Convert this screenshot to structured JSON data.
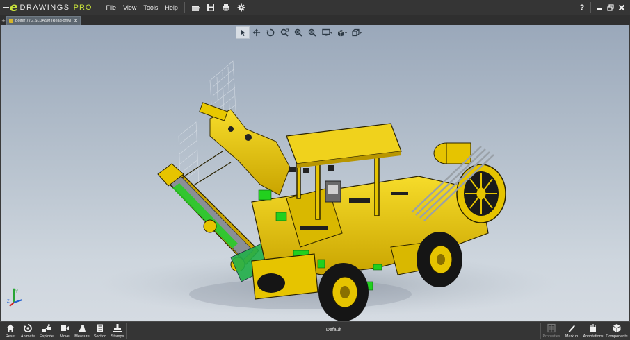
{
  "app": {
    "logo_word": "DRAWINGS",
    "logo_pro": "PRO",
    "menus": [
      "File",
      "View",
      "Tools",
      "Help"
    ],
    "help_glyph": "?"
  },
  "toolbar_icons": [
    "open-file-icon",
    "save-icon",
    "print-icon",
    "settings-gear-icon"
  ],
  "tabs": {
    "plus": "+",
    "document_tab": "Bolter 77G.SLDASM [Read-only]",
    "close_glyph": "✕"
  },
  "view_toolbar": {
    "tools": [
      "select-pointer-icon",
      "pan-icon",
      "rotate-icon",
      "zoom-to-fit-icon",
      "zoom-to-area-icon",
      "zoom-icon",
      "display-style-icon",
      "view-orientation-icon",
      "projection-icon"
    ]
  },
  "bottom_toolbar": {
    "left_buttons": [
      "Reset",
      "Animate",
      "Explode",
      "Move",
      "Measure",
      "Section",
      "Stamps"
    ],
    "configuration": "Default",
    "right_buttons": [
      "Properties",
      "Markup",
      "Annotations",
      "Components"
    ]
  },
  "colors": {
    "accent_green": "#c6e03a",
    "model_yellow": "#e6c400",
    "model_green": "#22d01e"
  }
}
